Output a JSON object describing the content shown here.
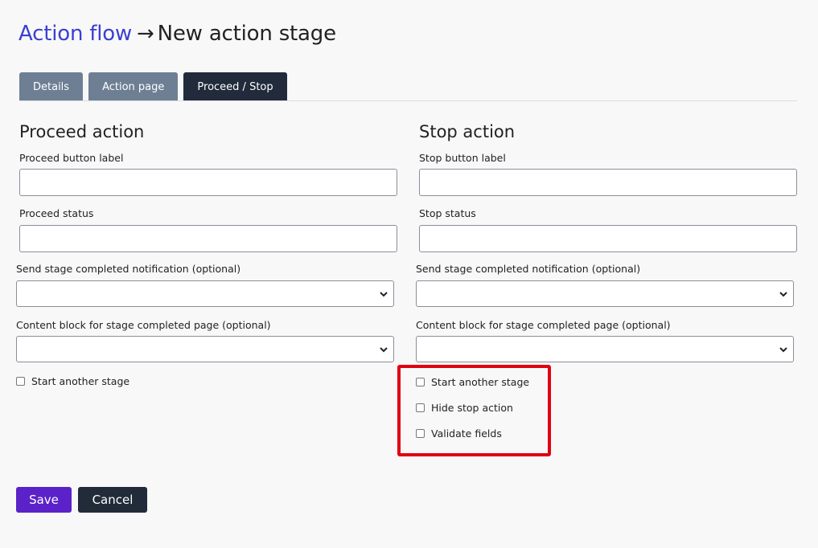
{
  "header": {
    "breadcrumb_link": "Action flow",
    "breadcrumb_separator": "→",
    "breadcrumb_current": "New action stage"
  },
  "tabs": [
    {
      "label": "Details"
    },
    {
      "label": "Action page"
    },
    {
      "label": "Proceed / Stop",
      "active": true
    }
  ],
  "proceed": {
    "title": "Proceed action",
    "button_label_label": "Proceed button label",
    "button_label_value": "",
    "status_label": "Proceed status",
    "status_value": "",
    "notification_label": "Send stage completed notification (optional)",
    "notification_value": "",
    "content_block_label": "Content block for stage completed page (optional)",
    "content_block_value": "",
    "start_another_label": "Start another stage"
  },
  "stop": {
    "title": "Stop action",
    "button_label_label": "Stop button label",
    "button_label_value": "",
    "status_label": "Stop status",
    "status_value": "",
    "notification_label": "Send stage completed notification (optional)",
    "notification_value": "",
    "content_block_label": "Content block for stage completed page (optional)",
    "content_block_value": "",
    "start_another_label": "Start another stage",
    "hide_stop_label": "Hide stop action",
    "validate_fields_label": "Validate fields"
  },
  "actions": {
    "save_label": "Save",
    "cancel_label": "Cancel"
  },
  "colors": {
    "link": "#3b3fd0",
    "tab_inactive": "#6e7f94",
    "tab_active": "#212b3b",
    "save_button": "#5b22c9",
    "cancel_button": "#222b39",
    "highlight": "#e00012"
  }
}
